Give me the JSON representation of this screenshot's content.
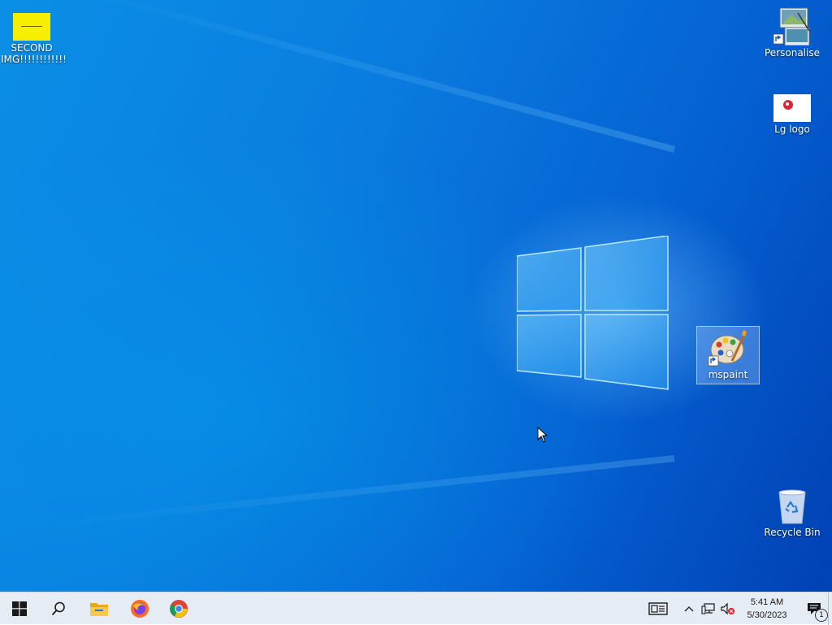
{
  "desktop": {
    "icons": [
      {
        "label": "SECOND IMG!!!!!!!!!!!!",
        "icon": "image-file-icon",
        "thumb_color": "#f6ef00"
      },
      {
        "label": "Personalise",
        "icon": "personalise-shortcut-icon"
      },
      {
        "label": "Lg logo",
        "icon": "image-file-icon"
      },
      {
        "label": "mspaint",
        "icon": "paint-palette-shortcut-icon",
        "selected": true
      },
      {
        "label": "Recycle Bin",
        "icon": "recycle-bin-icon"
      }
    ]
  },
  "taskbar": {
    "buttons": [
      {
        "name": "Start",
        "icon": "windows-start-icon"
      },
      {
        "name": "Search",
        "icon": "search-icon"
      },
      {
        "name": "File Explorer",
        "icon": "folder-icon"
      },
      {
        "name": "Firefox",
        "icon": "firefox-icon"
      },
      {
        "name": "Chrome",
        "icon": "chrome-icon"
      }
    ],
    "tray": {
      "time": "5:41 AM",
      "date": "5/30/2023",
      "notification_count": "1"
    },
    "background": "#e5ecf4"
  },
  "colors": {
    "desktop_blue": "#0a7ee0",
    "accent": "#0078d7"
  }
}
